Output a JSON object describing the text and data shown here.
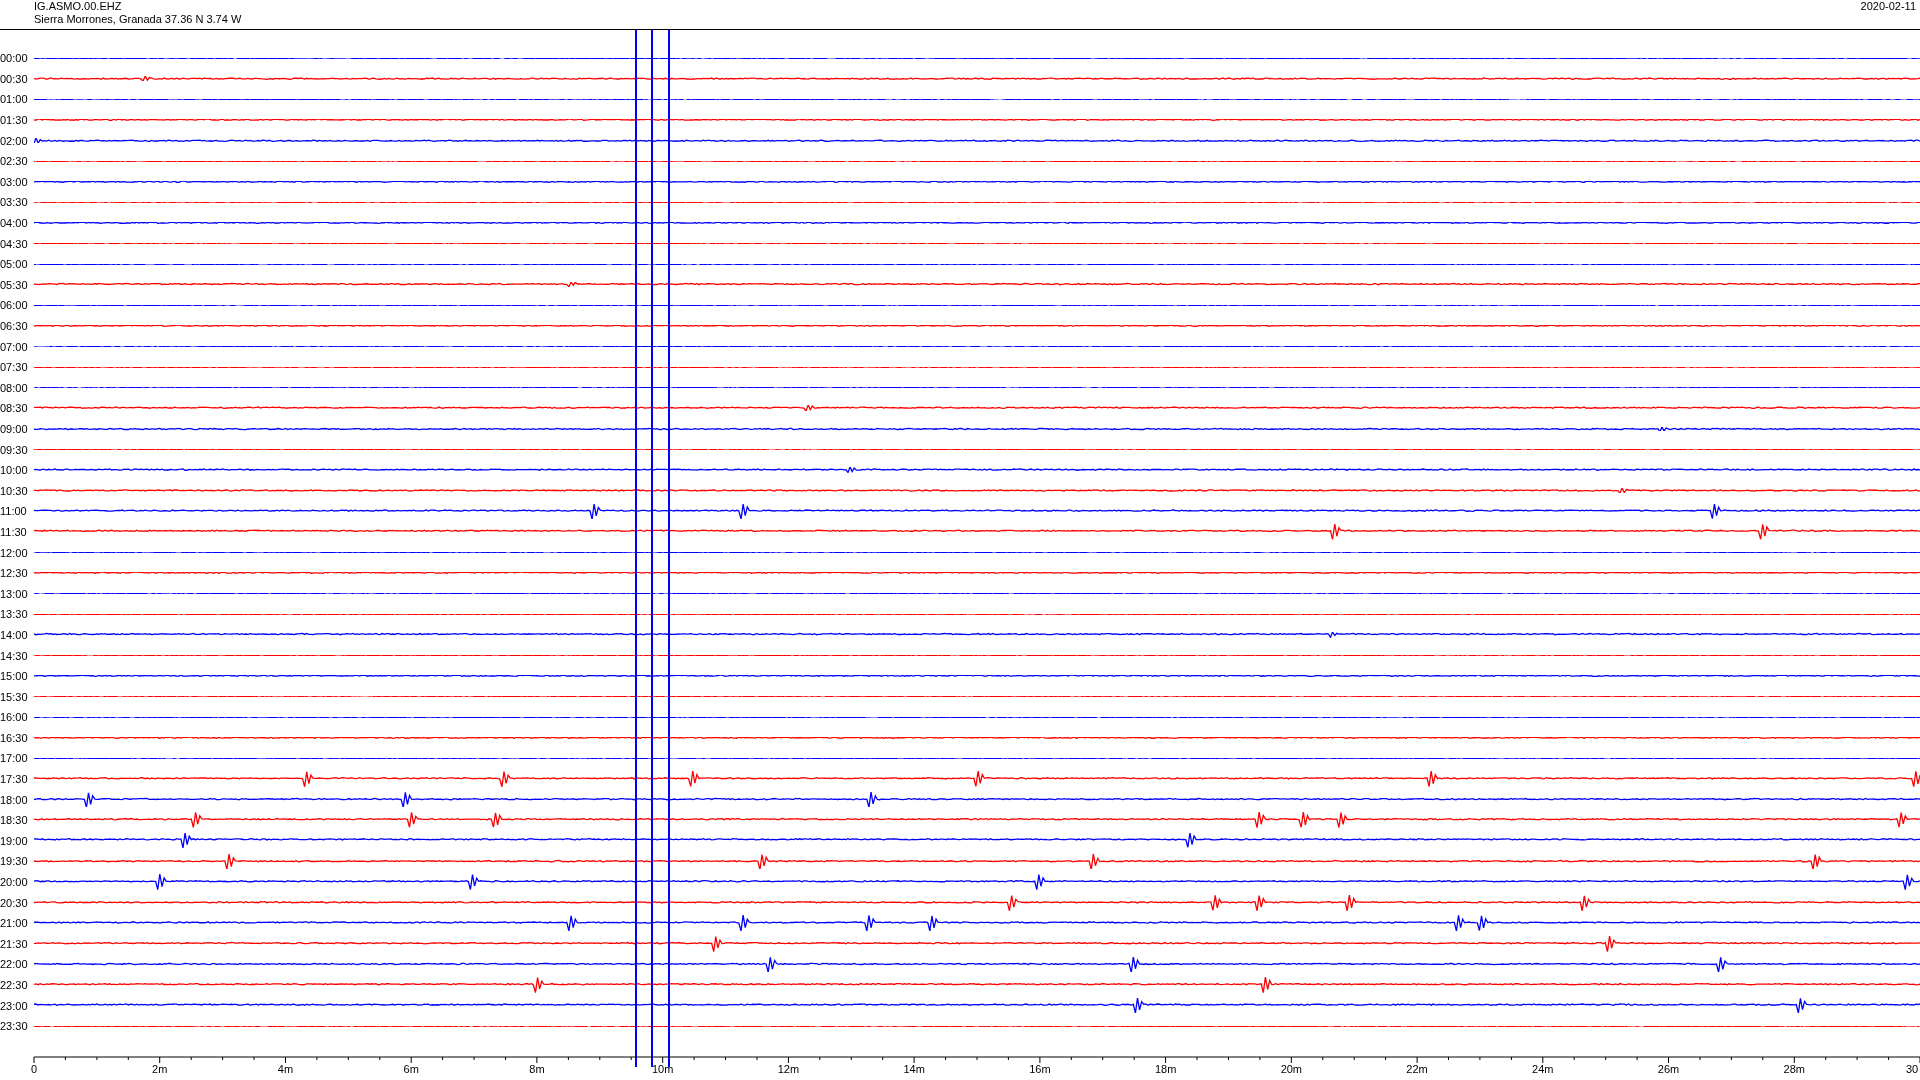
{
  "header": {
    "station": "IG.ASMO.00.EHZ",
    "location": "Sierra Morrones, Granada  37.36 N 3.74 W",
    "date": "2020-02-11"
  },
  "traces": [
    {
      "time": "00:00",
      "color": "#0000ff"
    },
    {
      "time": "00:30",
      "color": "#ff0000"
    },
    {
      "time": "01:00",
      "color": "#0000ff"
    },
    {
      "time": "01:30",
      "color": "#ff0000"
    },
    {
      "time": "02:00",
      "color": "#0000ff"
    },
    {
      "time": "02:30",
      "color": "#ff0000"
    },
    {
      "time": "03:00",
      "color": "#0000ff"
    },
    {
      "time": "03:30",
      "color": "#ff0000"
    },
    {
      "time": "04:00",
      "color": "#0000ff"
    },
    {
      "time": "04:30",
      "color": "#ff0000"
    },
    {
      "time": "05:00",
      "color": "#0000ff"
    },
    {
      "time": "05:30",
      "color": "#ff0000"
    },
    {
      "time": "06:00",
      "color": "#0000ff"
    },
    {
      "time": "06:30",
      "color": "#ff0000"
    },
    {
      "time": "07:00",
      "color": "#0000ff"
    },
    {
      "time": "07:30",
      "color": "#ff0000"
    },
    {
      "time": "08:00",
      "color": "#0000ff"
    },
    {
      "time": "08:30",
      "color": "#ff0000"
    },
    {
      "time": "09:00",
      "color": "#0000ff"
    },
    {
      "time": "09:30",
      "color": "#ff0000"
    },
    {
      "time": "10:00",
      "color": "#0000ff"
    },
    {
      "time": "10:30",
      "color": "#ff0000"
    },
    {
      "time": "11:00",
      "color": "#0000ff"
    },
    {
      "time": "11:30",
      "color": "#ff0000"
    },
    {
      "time": "12:00",
      "color": "#0000ff"
    },
    {
      "time": "12:30",
      "color": "#ff0000"
    },
    {
      "time": "13:00",
      "color": "#0000ff"
    },
    {
      "time": "13:30",
      "color": "#ff0000"
    },
    {
      "time": "14:00",
      "color": "#0000ff"
    },
    {
      "time": "14:30",
      "color": "#ff0000"
    },
    {
      "time": "15:00",
      "color": "#0000ff"
    },
    {
      "time": "15:30",
      "color": "#ff0000"
    },
    {
      "time": "16:00",
      "color": "#0000ff"
    },
    {
      "time": "16:30",
      "color": "#ff0000"
    },
    {
      "time": "17:00",
      "color": "#0000ff"
    },
    {
      "time": "17:30",
      "color": "#ff0000"
    },
    {
      "time": "18:00",
      "color": "#0000ff"
    },
    {
      "time": "18:30",
      "color": "#ff0000"
    },
    {
      "time": "19:00",
      "color": "#0000ff"
    },
    {
      "time": "19:30",
      "color": "#ff0000"
    },
    {
      "time": "20:00",
      "color": "#0000ff"
    },
    {
      "time": "20:30",
      "color": "#ff0000"
    },
    {
      "time": "21:00",
      "color": "#0000ff"
    },
    {
      "time": "21:30",
      "color": "#ff0000"
    },
    {
      "time": "22:00",
      "color": "#0000ff"
    },
    {
      "time": "22:30",
      "color": "#ff0000"
    },
    {
      "time": "23:00",
      "color": "#0000ff"
    },
    {
      "time": "23:30",
      "color": "#ff0000"
    }
  ],
  "x_axis": {
    "labels": [
      "0",
      "2m",
      "4m",
      "6m",
      "8m",
      "10m",
      "12m",
      "14m",
      "16m",
      "18m",
      "20m",
      "22m",
      "24m",
      "26m",
      "28m",
      "30"
    ]
  }
}
